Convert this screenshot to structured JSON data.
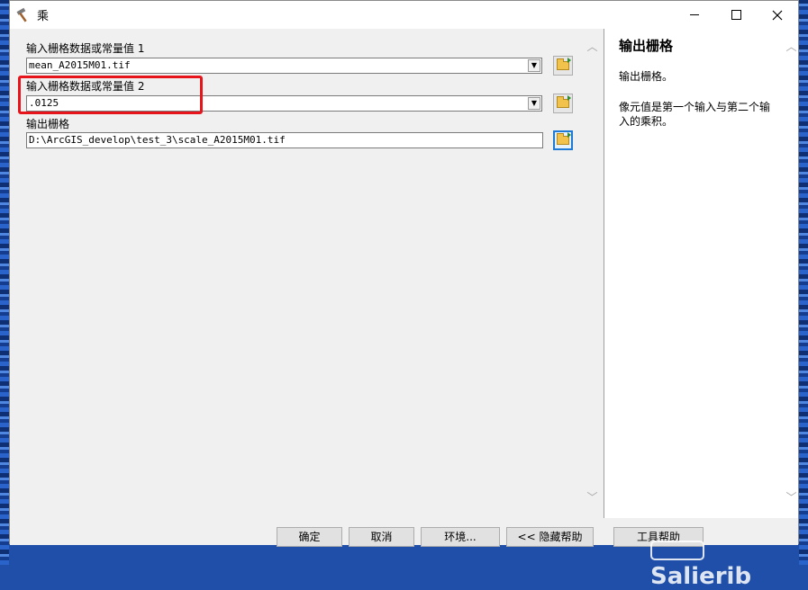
{
  "window": {
    "title": "乘",
    "title_icon": "hammer-icon"
  },
  "params": [
    {
      "label": "输入栅格数据或常量值 1",
      "value": "mean_A2015M01.tif",
      "has_dropdown": true
    },
    {
      "label": "输入栅格数据或常量值 2",
      "value": ".0125",
      "has_dropdown": true
    },
    {
      "label": "输出栅格",
      "value": "D:\\ArcGIS_develop\\test_3\\scale_A2015M01.tif",
      "has_dropdown": false
    }
  ],
  "help": {
    "title": "输出栅格",
    "paragraphs": [
      "输出栅格。",
      "像元值是第一个输入与第二个输入的乘积。"
    ]
  },
  "footer": {
    "ok": "确定",
    "cancel": "取消",
    "environments": "环境...",
    "hide_help": "<< 隐藏帮助",
    "tool_help": "工具帮助"
  },
  "watermark": "Salierib",
  "colors": {
    "highlight": "#e8141b",
    "accent": "#1f7ad6",
    "background": "#1f4fa8"
  }
}
